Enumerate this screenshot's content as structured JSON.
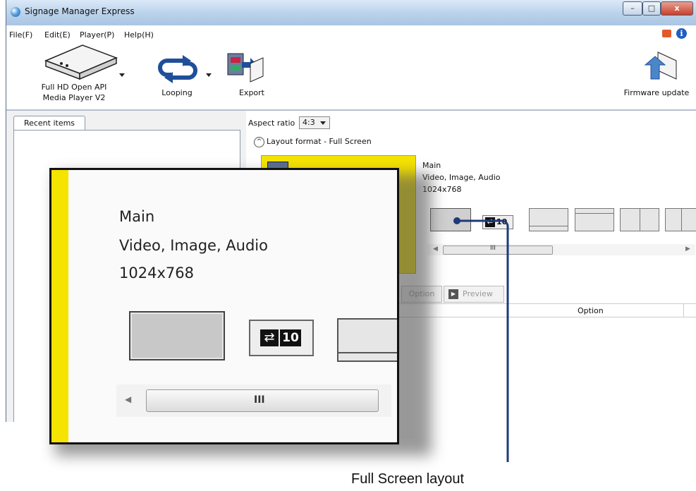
{
  "window": {
    "title": "Signage Manager Express",
    "controls": {
      "minimize": "–",
      "maximize": "□",
      "close": "x"
    }
  },
  "menubar": {
    "items": [
      "File(F)",
      "Edit(E)",
      "Player(P)",
      "Help(H)"
    ]
  },
  "toolbar": {
    "player_label_line1": "Full HD Open API",
    "player_label_line2": "Media Player V2",
    "looping_label": "Looping",
    "export_label": "Export",
    "firmware_label": "Firmware update"
  },
  "left_panel": {
    "tab_label": "Recent items"
  },
  "right_panel": {
    "aspect_label": "Aspect ratio",
    "aspect_value": "4:3",
    "layout_format": "Layout format - Full Screen",
    "zone_name": "Main",
    "zone_types": "Video, Image, Audio",
    "zone_resolution": "1024x768",
    "scrollbar_grip": "III",
    "option_button": "Option",
    "preview_button": "Preview",
    "table_header_option": "Option",
    "loop_badge": "10"
  },
  "zoom": {
    "zone_name": "Main",
    "zone_types": "Video, Image, Audio",
    "zone_resolution": "1024x768",
    "loop_badge": "10",
    "scrollbar_grip": "III"
  },
  "callout": {
    "label": "Full Screen layout"
  },
  "colors": {
    "accent_yellow": "#f5e300",
    "callout_line": "#1c3b78",
    "titlebar": "#c4d9f0"
  }
}
